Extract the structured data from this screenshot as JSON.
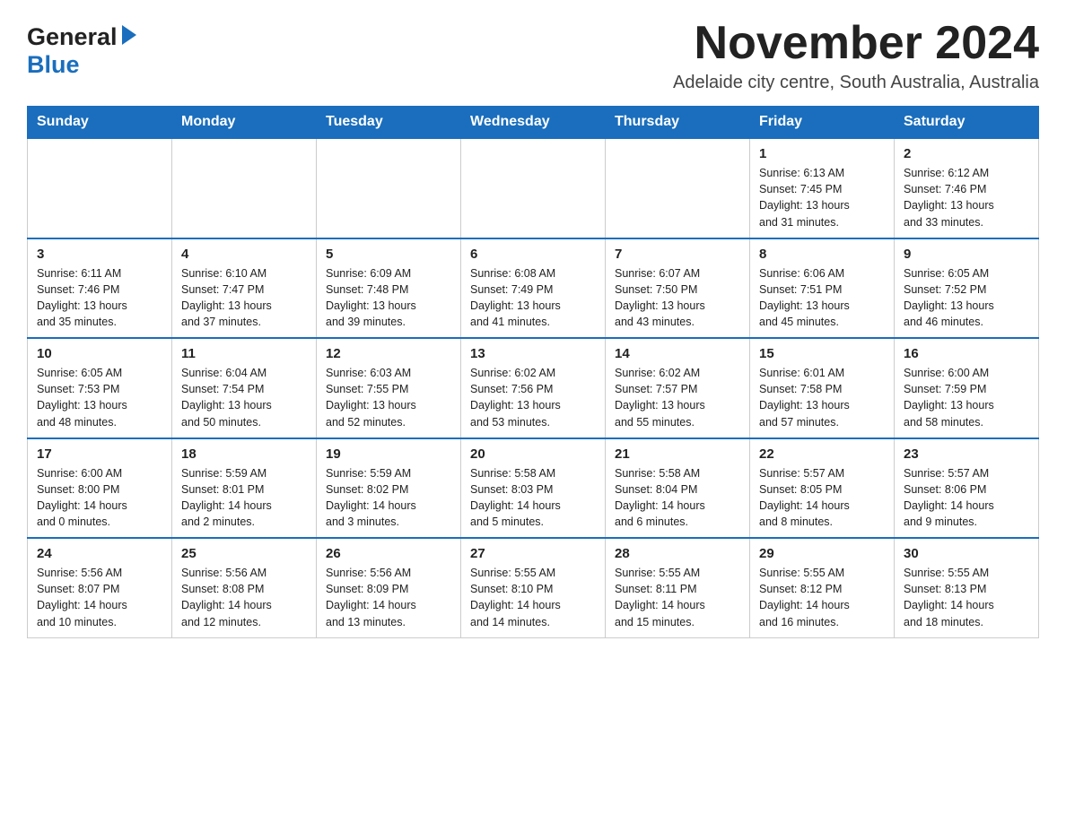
{
  "header": {
    "logo_general": "General",
    "logo_blue": "Blue",
    "month_title": "November 2024",
    "location": "Adelaide city centre, South Australia, Australia"
  },
  "weekdays": [
    "Sunday",
    "Monday",
    "Tuesday",
    "Wednesday",
    "Thursday",
    "Friday",
    "Saturday"
  ],
  "weeks": [
    [
      {
        "day": "",
        "info": ""
      },
      {
        "day": "",
        "info": ""
      },
      {
        "day": "",
        "info": ""
      },
      {
        "day": "",
        "info": ""
      },
      {
        "day": "",
        "info": ""
      },
      {
        "day": "1",
        "info": "Sunrise: 6:13 AM\nSunset: 7:45 PM\nDaylight: 13 hours\nand 31 minutes."
      },
      {
        "day": "2",
        "info": "Sunrise: 6:12 AM\nSunset: 7:46 PM\nDaylight: 13 hours\nand 33 minutes."
      }
    ],
    [
      {
        "day": "3",
        "info": "Sunrise: 6:11 AM\nSunset: 7:46 PM\nDaylight: 13 hours\nand 35 minutes."
      },
      {
        "day": "4",
        "info": "Sunrise: 6:10 AM\nSunset: 7:47 PM\nDaylight: 13 hours\nand 37 minutes."
      },
      {
        "day": "5",
        "info": "Sunrise: 6:09 AM\nSunset: 7:48 PM\nDaylight: 13 hours\nand 39 minutes."
      },
      {
        "day": "6",
        "info": "Sunrise: 6:08 AM\nSunset: 7:49 PM\nDaylight: 13 hours\nand 41 minutes."
      },
      {
        "day": "7",
        "info": "Sunrise: 6:07 AM\nSunset: 7:50 PM\nDaylight: 13 hours\nand 43 minutes."
      },
      {
        "day": "8",
        "info": "Sunrise: 6:06 AM\nSunset: 7:51 PM\nDaylight: 13 hours\nand 45 minutes."
      },
      {
        "day": "9",
        "info": "Sunrise: 6:05 AM\nSunset: 7:52 PM\nDaylight: 13 hours\nand 46 minutes."
      }
    ],
    [
      {
        "day": "10",
        "info": "Sunrise: 6:05 AM\nSunset: 7:53 PM\nDaylight: 13 hours\nand 48 minutes."
      },
      {
        "day": "11",
        "info": "Sunrise: 6:04 AM\nSunset: 7:54 PM\nDaylight: 13 hours\nand 50 minutes."
      },
      {
        "day": "12",
        "info": "Sunrise: 6:03 AM\nSunset: 7:55 PM\nDaylight: 13 hours\nand 52 minutes."
      },
      {
        "day": "13",
        "info": "Sunrise: 6:02 AM\nSunset: 7:56 PM\nDaylight: 13 hours\nand 53 minutes."
      },
      {
        "day": "14",
        "info": "Sunrise: 6:02 AM\nSunset: 7:57 PM\nDaylight: 13 hours\nand 55 minutes."
      },
      {
        "day": "15",
        "info": "Sunrise: 6:01 AM\nSunset: 7:58 PM\nDaylight: 13 hours\nand 57 minutes."
      },
      {
        "day": "16",
        "info": "Sunrise: 6:00 AM\nSunset: 7:59 PM\nDaylight: 13 hours\nand 58 minutes."
      }
    ],
    [
      {
        "day": "17",
        "info": "Sunrise: 6:00 AM\nSunset: 8:00 PM\nDaylight: 14 hours\nand 0 minutes."
      },
      {
        "day": "18",
        "info": "Sunrise: 5:59 AM\nSunset: 8:01 PM\nDaylight: 14 hours\nand 2 minutes."
      },
      {
        "day": "19",
        "info": "Sunrise: 5:59 AM\nSunset: 8:02 PM\nDaylight: 14 hours\nand 3 minutes."
      },
      {
        "day": "20",
        "info": "Sunrise: 5:58 AM\nSunset: 8:03 PM\nDaylight: 14 hours\nand 5 minutes."
      },
      {
        "day": "21",
        "info": "Sunrise: 5:58 AM\nSunset: 8:04 PM\nDaylight: 14 hours\nand 6 minutes."
      },
      {
        "day": "22",
        "info": "Sunrise: 5:57 AM\nSunset: 8:05 PM\nDaylight: 14 hours\nand 8 minutes."
      },
      {
        "day": "23",
        "info": "Sunrise: 5:57 AM\nSunset: 8:06 PM\nDaylight: 14 hours\nand 9 minutes."
      }
    ],
    [
      {
        "day": "24",
        "info": "Sunrise: 5:56 AM\nSunset: 8:07 PM\nDaylight: 14 hours\nand 10 minutes."
      },
      {
        "day": "25",
        "info": "Sunrise: 5:56 AM\nSunset: 8:08 PM\nDaylight: 14 hours\nand 12 minutes."
      },
      {
        "day": "26",
        "info": "Sunrise: 5:56 AM\nSunset: 8:09 PM\nDaylight: 14 hours\nand 13 minutes."
      },
      {
        "day": "27",
        "info": "Sunrise: 5:55 AM\nSunset: 8:10 PM\nDaylight: 14 hours\nand 14 minutes."
      },
      {
        "day": "28",
        "info": "Sunrise: 5:55 AM\nSunset: 8:11 PM\nDaylight: 14 hours\nand 15 minutes."
      },
      {
        "day": "29",
        "info": "Sunrise: 5:55 AM\nSunset: 8:12 PM\nDaylight: 14 hours\nand 16 minutes."
      },
      {
        "day": "30",
        "info": "Sunrise: 5:55 AM\nSunset: 8:13 PM\nDaylight: 14 hours\nand 18 minutes."
      }
    ]
  ]
}
